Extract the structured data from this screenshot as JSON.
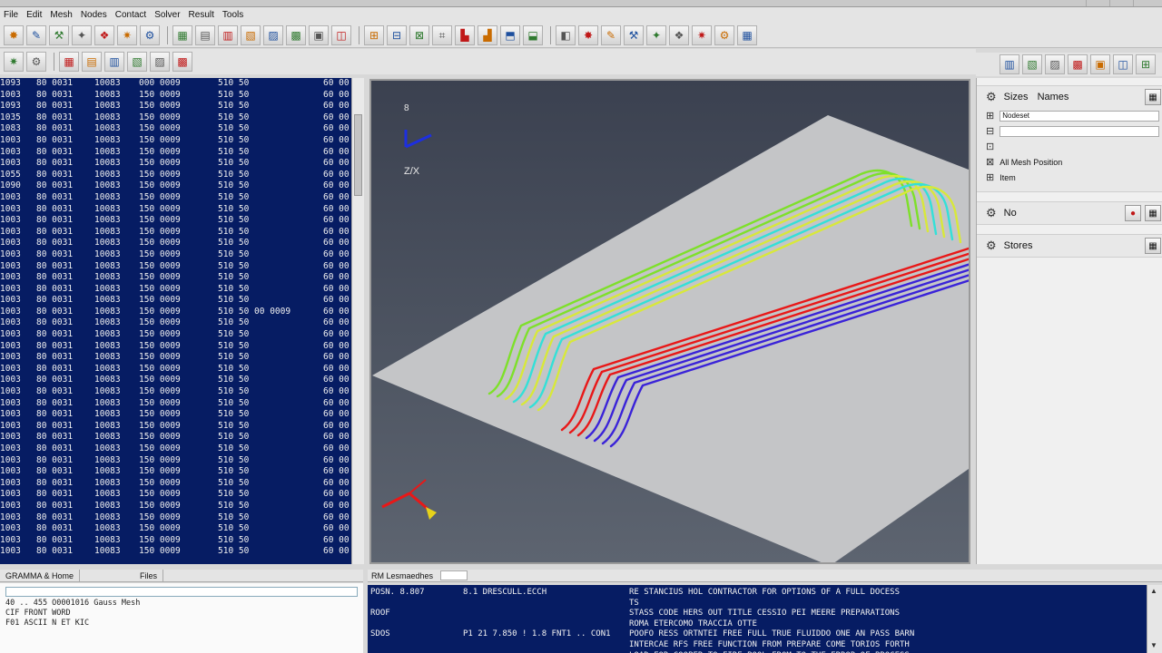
{
  "titlebar": {
    "title": ""
  },
  "menu": [
    "File",
    "Edit",
    "Mesh",
    "Nodes",
    "Contact",
    "Solver",
    "Result",
    "Tools"
  ],
  "toolbar1": {
    "groups": [
      [
        "tool-icon",
        "tool-icon",
        "tool-icon",
        "tool-icon",
        "tool-icon",
        "tool-icon",
        "tool-icon"
      ],
      [
        "tool-icon",
        "tool-icon",
        "tool-icon",
        "tool-icon",
        "tool-icon",
        "tool-icon",
        "tool-icon",
        "tool-icon"
      ],
      [
        "tool-icon",
        "tool-icon",
        "tool-icon",
        "tool-icon",
        "tool-icon",
        "tool-icon",
        "tool-icon",
        "tool-icon"
      ],
      [
        "tool-icon",
        "tool-icon",
        "tool-icon",
        "tool-icon",
        "tool-icon",
        "tool-icon",
        "tool-icon",
        "tool-icon",
        "tool-icon"
      ]
    ]
  },
  "toolbar2": {
    "count": 8
  },
  "toolbar3": {
    "count": 7
  },
  "listing": {
    "rows": [
      [
        "1093",
        "80 0031",
        "10083",
        "000 0009",
        "510 50",
        "60 00"
      ],
      [
        "1003",
        "80 0031",
        "10083",
        "150 0009",
        "510 50",
        "60 00"
      ],
      [
        "1093",
        "80 0031",
        "10083",
        "150 0009",
        "510 50",
        "60 00"
      ],
      [
        "1035",
        "80 0031",
        "10083",
        "150 0009",
        "510 50",
        "60 00"
      ],
      [
        "1083",
        "80 0031",
        "10083",
        "150 0009",
        "510 50",
        "60 00"
      ],
      [
        "1003",
        "80 0031",
        "10083",
        "150 0009",
        "510 50",
        "60 00"
      ],
      [
        "1003",
        "80 0031",
        "10083",
        "150 0009",
        "510 50",
        "60 00"
      ],
      [
        "1003",
        "80 0031",
        "10083",
        "150 0009",
        "510 50",
        "60 00"
      ],
      [
        "1055",
        "80 0031",
        "10083",
        "150 0009",
        "510 50",
        "60 00"
      ],
      [
        "1090",
        "80 0031",
        "10083",
        "150 0009",
        "510 50",
        "60 00"
      ],
      [
        "1003",
        "80 0031",
        "10083",
        "150 0009",
        "510 50",
        "60 00"
      ],
      [
        "1003",
        "80 0031",
        "10083",
        "150 0009",
        "510 50",
        "60 00"
      ],
      [
        "1003",
        "80 0031",
        "10083",
        "150 0009",
        "510 50",
        "60 00"
      ],
      [
        "1003",
        "80 0031",
        "10083",
        "150 0009",
        "510 50",
        "60 00"
      ],
      [
        "1003",
        "80 0031",
        "10083",
        "150 0009",
        "510 50",
        "60 00"
      ],
      [
        "1003",
        "80 0031",
        "10083",
        "150 0009",
        "510 50",
        "60 00"
      ],
      [
        "1003",
        "80 0031",
        "10083",
        "150 0009",
        "510 50",
        "60 00"
      ],
      [
        "1003",
        "80 0031",
        "10083",
        "150 0009",
        "510 50",
        "60 00"
      ],
      [
        "1003",
        "80 0031",
        "10083",
        "150 0009",
        "510 50",
        "60 00"
      ],
      [
        "1003",
        "80 0031",
        "10083",
        "150 0009",
        "510 50",
        "60 00"
      ],
      [
        "1003",
        "80 0031",
        "10083",
        "150 0009",
        "510 50 00 0009",
        "60 00"
      ],
      [
        "1003",
        "80 0031",
        "10083",
        "150 0009",
        "510 50",
        "60 00"
      ],
      [
        "1003",
        "80 0031",
        "10083",
        "150 0009",
        "510 50",
        "60 00"
      ],
      [
        "1003",
        "80 0031",
        "10083",
        "150 0009",
        "510 50",
        "60 00"
      ],
      [
        "1003",
        "80 0031",
        "10083",
        "150 0009",
        "510 50",
        "60 00"
      ],
      [
        "1003",
        "80 0031",
        "10083",
        "150 0009",
        "510 50",
        "60 00"
      ],
      [
        "1003",
        "80 0031",
        "10083",
        "150 0009",
        "510 50",
        "60 00"
      ],
      [
        "1003",
        "80 0031",
        "10083",
        "150 0009",
        "510 50",
        "60 00"
      ],
      [
        "1003",
        "80 0031",
        "10083",
        "150 0009",
        "510 50",
        "60 00"
      ],
      [
        "1003",
        "80 0031",
        "10083",
        "150 0009",
        "510 50",
        "60 00"
      ],
      [
        "1003",
        "80 0031",
        "10083",
        "150 0009",
        "510 50",
        "60 00"
      ],
      [
        "1003",
        "80 0031",
        "10083",
        "150 0009",
        "510 50",
        "60 00"
      ],
      [
        "1003",
        "80 0031",
        "10083",
        "150 0009",
        "510 50",
        "60 00"
      ],
      [
        "1003",
        "80 0031",
        "10083",
        "150 0009",
        "510 50",
        "60 00"
      ],
      [
        "1003",
        "80 0031",
        "10083",
        "150 0009",
        "510 50",
        "60 00"
      ],
      [
        "1003",
        "80 0031",
        "10083",
        "150 0009",
        "510 50",
        "60 00"
      ],
      [
        "1003",
        "80 0031",
        "10083",
        "150 0009",
        "510 50",
        "60 00"
      ],
      [
        "1003",
        "80 0031",
        "10083",
        "150 0009",
        "510 50",
        "60 00"
      ],
      [
        "1003",
        "80 0031",
        "10083",
        "150 0009",
        "510 50",
        "60 00"
      ],
      [
        "1003",
        "80 0031",
        "10083",
        "150 0009",
        "510 50",
        "60 00"
      ],
      [
        "1003",
        "80 0031",
        "10083",
        "150 0009",
        "510 50",
        "60 00"
      ],
      [
        "1003",
        "80 0031",
        "10083",
        "150 0009",
        "510 50",
        "60 00"
      ]
    ]
  },
  "viewport": {
    "corner_label": "",
    "triad_top_label": "8",
    "triad_top_text": "Z/X",
    "triad_bottom_label": "",
    "colors": {
      "background_top": "#3b4150",
      "plane": "#c4c5c7",
      "green": "#7ee02a",
      "yellow": "#d8e83a",
      "cyan": "#33e0d8",
      "red": "#e81818",
      "blue": "#3a23d8"
    }
  },
  "right_panel": {
    "section1": {
      "title": "Sizes",
      "tab": "Names",
      "row1_label": "",
      "row1_value": "Nodeset",
      "row2_label": "",
      "row2_value": "",
      "row3_label": "",
      "row3_value": "",
      "row4": "All Mesh Position",
      "row5": "Item"
    },
    "section2": {
      "title": "No"
    },
    "section3": {
      "title": "Stores"
    }
  },
  "log": {
    "tab1": "GRAMMA & Home",
    "tab2": "Files",
    "lines": [
      "40 .. 455 O0001016 Gauss Mesh",
      "CIF  FRONT WORD",
      "F01 ASCII N ET KIC"
    ]
  },
  "messages": {
    "header_label": "RM Lesmaedhes",
    "header_value": "",
    "lines": [
      {
        "c1": "POSN. 8.807",
        "c2": "8.1 DRESCULL.ECCH",
        "c3": "RE STANCIUS HOL CONTRACTOR FOR OPTIONS OF A FULL DOCESS"
      },
      {
        "c1": "",
        "c2": "",
        "c3": "TS"
      },
      {
        "c1": "ROOF",
        "c2": "",
        "c3": "STASS CODE HERS OUT TITLE CESSIO PEI MEERE PREPARATIONS"
      },
      {
        "c1": "",
        "c2": "",
        "c3": "ROMA ETERCOMO TRACCIA OTTE"
      },
      {
        "c1": "SDOS",
        "c2": "P1 21 7.850 ! 1.8 FNT1 .. CON1",
        "c3": "POOFO RESS ORTNTEI FREE FULL TRUE FLUIDDO ONE AN PASS BARN"
      },
      {
        "c1": "",
        "c2": "",
        "c3": "INTERCAE RFS FREE FUNCTION FROM PREPARE COME TORIOS FORTH"
      },
      {
        "c1": "",
        "c2": "",
        "c3": "LOAD FOR COOPER TO FIRE POOL FROM TO THE ERROR OF PROCESS"
      }
    ]
  }
}
